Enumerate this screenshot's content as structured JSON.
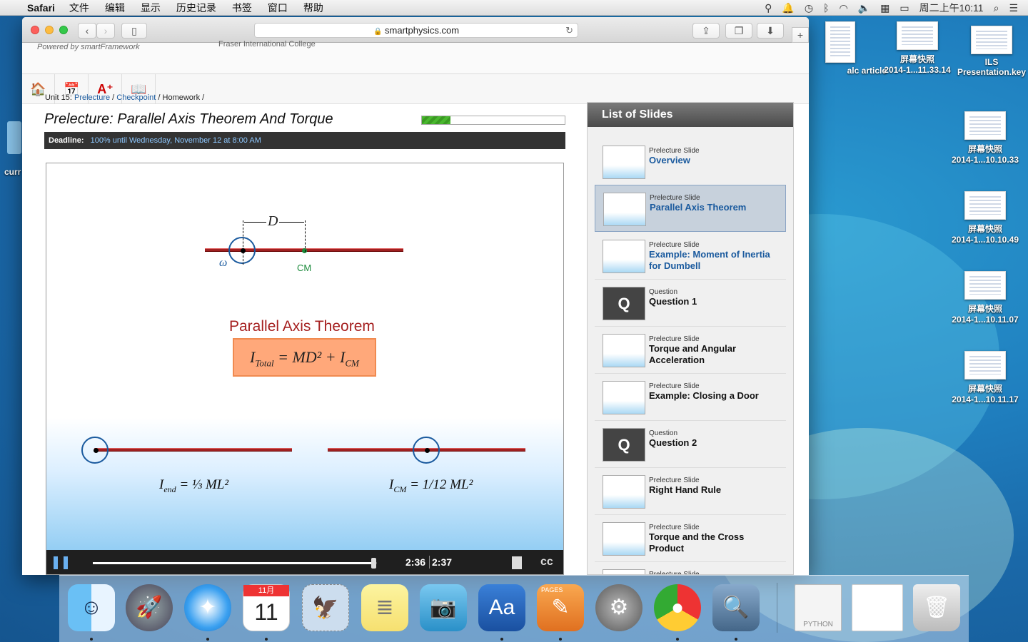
{
  "menubar": {
    "app": "Safari",
    "items": [
      "文件",
      "编辑",
      "显示",
      "历史记录",
      "书签",
      "窗口",
      "帮助"
    ],
    "clock": "周二上午10:11"
  },
  "desktop": {
    "icons": [
      {
        "label": "alc article",
        "sub": ""
      },
      {
        "label": "屏幕快照",
        "sub": "2014-1...11.33.14"
      },
      {
        "label": "ILS",
        "sub": "Presentation.key"
      },
      {
        "label": "屏幕快照",
        "sub": "2014-1...10.10.33"
      },
      {
        "label": "屏幕快照",
        "sub": "2014-1...10.10.49"
      },
      {
        "label": "屏幕快照",
        "sub": "2014-1...10.11.07"
      },
      {
        "label": "屏幕快照",
        "sub": "2014-1...10.11.17"
      }
    ],
    "left_label": "curr"
  },
  "browser": {
    "url": "smartphysics.com",
    "powered": "Powered by smartFramework",
    "college": "Fraser International College"
  },
  "breadcrumb": {
    "unit": "Unit 15:",
    "prelecture": "Prelecture",
    "checkpoint": "Checkpoint",
    "homework": "Homework"
  },
  "page": {
    "title": "Prelecture: Parallel Axis Theorem And Torque",
    "progress": 0.2,
    "deadline_label": "Deadline:",
    "deadline_value": "100% until Wednesday, November 12 at 8:00 AM"
  },
  "slide": {
    "d_label": "D",
    "omega": "ω",
    "cm": "CM",
    "theorem_title": "Parallel Axis Theorem",
    "formula_main": "I",
    "formula_main_sub": "Total",
    "formula_main_rhs": "= MD² + I",
    "formula_main_rhs_sub": "CM",
    "formula_left": "I",
    "formula_left_sub": "end",
    "formula_left_rhs": "= ⅓ ML²",
    "formula_right": "I",
    "formula_right_sub": "CM",
    "formula_right_rhs": "= 1/12 ML²"
  },
  "player": {
    "time_current": "2:36",
    "time_total": "2:37",
    "position": 0.99
  },
  "slide_list": {
    "header": "List of Slides",
    "items": [
      {
        "kind": "Prelecture Slide",
        "name": "Overview"
      },
      {
        "kind": "Prelecture Slide",
        "name": "Parallel Axis Theorem"
      },
      {
        "kind": "Prelecture Slide",
        "name": "Example: Moment of Inertia for Dumbell"
      },
      {
        "kind": "Question",
        "name": "Question 1"
      },
      {
        "kind": "Prelecture Slide",
        "name": "Torque and Angular Acceleration"
      },
      {
        "kind": "Prelecture Slide",
        "name": "Example: Closing a Door"
      },
      {
        "kind": "Question",
        "name": "Question 2"
      },
      {
        "kind": "Prelecture Slide",
        "name": "Right Hand Rule"
      },
      {
        "kind": "Prelecture Slide",
        "name": "Torque and the Cross Product"
      },
      {
        "kind": "Prelecture Slide",
        "name": ""
      }
    ]
  },
  "dock": {
    "calendar_month": "11月",
    "calendar_day": "11",
    "pages_label": "PAGES",
    "python_label": "PYTHON"
  }
}
